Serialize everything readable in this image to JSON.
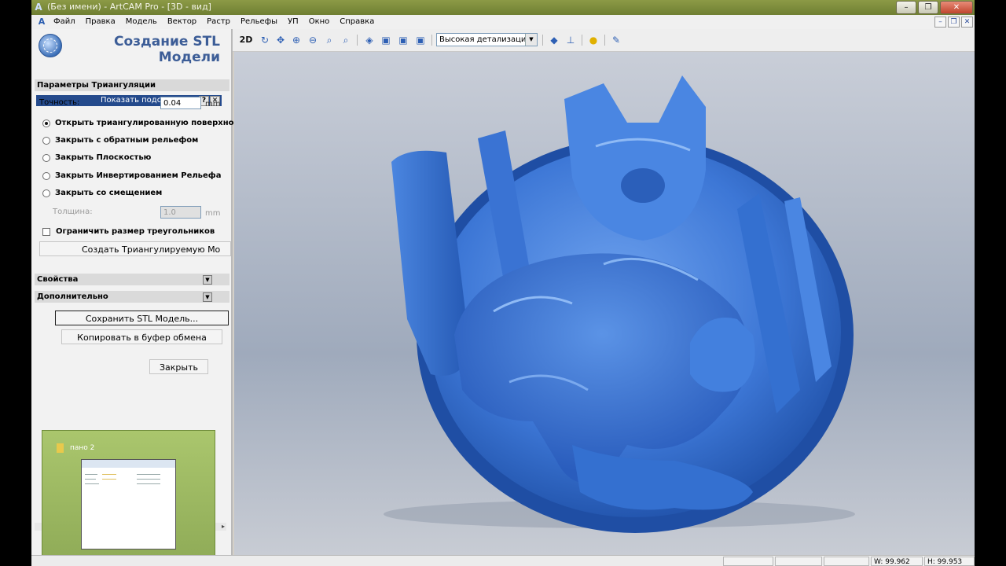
{
  "window": {
    "title": "(Без имени) - ArtCAM Pro - [3D - вид]"
  },
  "menu": [
    "Файл",
    "Правка",
    "Модель",
    "Вектор",
    "Растр",
    "Рельефы",
    "УП",
    "Окно",
    "Справка"
  ],
  "panel": {
    "title_line1": "Создание STL",
    "title_line2": "Модели",
    "hint_label": "Показать подсказку",
    "hint_help": "?",
    "hint_close": "✕",
    "section_triangulation": "Параметры Триангуляции",
    "precision_label": "Точность:",
    "precision_value": "0.04",
    "unit": "mm",
    "radios": [
      {
        "label": "Открыть триангулированную поверхнос",
        "checked": true
      },
      {
        "label": "Закрыть с обратным рельефом",
        "checked": false
      },
      {
        "label": "Закрыть Плоскостью",
        "checked": false
      },
      {
        "label": "Закрыть Инвертированием Рельефа",
        "checked": false
      },
      {
        "label": "Закрыть со смещением",
        "checked": false
      }
    ],
    "thickness_label": "Толщина:",
    "thickness_value": "1.0",
    "limit_label": "Ограничить размер треугольников",
    "create_button": "Создать Триангулируемую Мо",
    "section_properties": "Свойства",
    "section_advanced": "Дополнительно",
    "save_button": "Сохранить STL Модель...",
    "copy_button": "Копировать в буфер обмена",
    "close_button": "Закрыть"
  },
  "thumbnail": {
    "label": "пано 2"
  },
  "toolbar": {
    "mode_2d": "2D",
    "detail_value": "Высокая детализация"
  },
  "status": {
    "w": "W: 99.962",
    "h": "H: 99.953"
  },
  "colors": {
    "model_blue": "#3d77d6",
    "panel_header": "#244a8c",
    "titlebar": "#7a8a3c"
  }
}
